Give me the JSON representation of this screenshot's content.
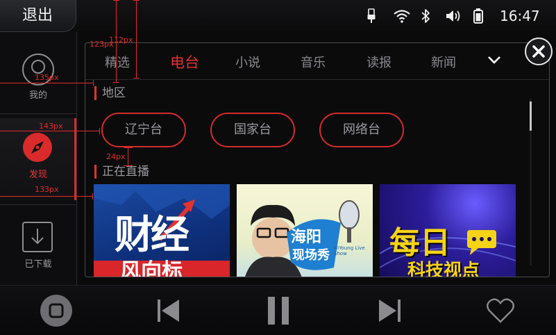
{
  "topbar": {
    "exit_label": "退出",
    "time": "16:47",
    "icons": [
      "usb-icon",
      "wifi-icon",
      "bluetooth-icon",
      "volume-icon",
      "battery-icon"
    ]
  },
  "nav": {
    "items": [
      {
        "label": "我的",
        "icon": "profile-icon"
      },
      {
        "label": "发现",
        "icon": "compass-icon",
        "active": true
      },
      {
        "label": "已下载",
        "icon": "download-icon"
      }
    ]
  },
  "tabs": [
    {
      "label": "精选"
    },
    {
      "label": "电台",
      "active": true
    },
    {
      "label": "小说"
    },
    {
      "label": "音乐"
    },
    {
      "label": "读报"
    },
    {
      "label": "新闻"
    }
  ],
  "sections": {
    "region_title": "地区",
    "region_pills": [
      "辽宁台",
      "国家台",
      "网络台"
    ],
    "live_title": "正在直播"
  },
  "cards": [
    {
      "text": "财经",
      "subtext": "风向标"
    },
    {
      "text": "海阳",
      "subtext": "现场秀",
      "tag": "HiYoung Live Show"
    },
    {
      "text": "每日",
      "subtext": "科技视点"
    }
  ],
  "measurements": [
    "112px",
    "123px",
    "135px",
    "143px",
    "24px",
    "133px"
  ],
  "colors": {
    "accent": "#e33232",
    "background": "#0a0a0b",
    "text_muted": "#9b9ba0"
  }
}
